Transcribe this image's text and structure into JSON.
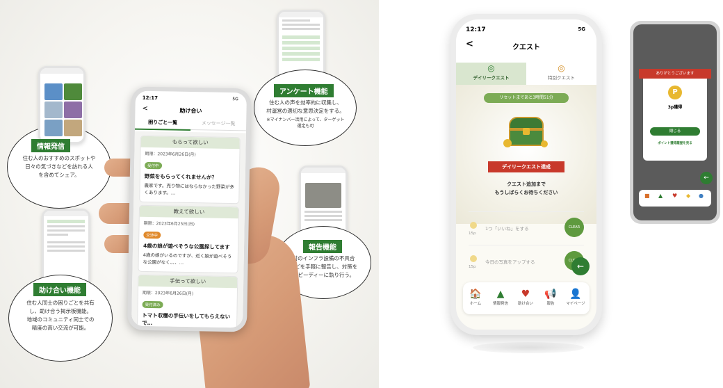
{
  "left": {
    "info_tag": "情報発信",
    "info_desc": "住む人のおすすめのスポットや\n日々の気づきなどを訪れる人\nを含めてシェア。",
    "survey_tag": "アンケート機能",
    "survey_desc": "住む人の声を効率的に収集し、\n村運営の適切な意思決定をする。",
    "survey_note": "※マイナンバー活用によって、ターゲット\n選定も可",
    "help_tag": "助け合い機能",
    "help_desc": "住む人同士の困りごとを共有\nし、助け合う掲示板機能。\n地域のコミュニティ同士での\n精度の高い交流が可能。",
    "report_tag": "報告機能",
    "report_desc": "村のインフラ設備の不具合\nなどを手軽に報告し、対策を\nスピーディーに執り行う。"
  },
  "main_phone": {
    "time": "12:17",
    "signal": "5G",
    "back": "<",
    "title": "助け合い",
    "tab_active": "困りごと一覧",
    "tab_inactive": "メッセージ一覧",
    "cards": [
      {
        "head": "もらって欲しい",
        "date": "期限：2023年6月26日(月)",
        "badge": "受付中",
        "title": "野菜をもらってくれませんか？",
        "body": "農家です。売り物にはならなかった野菜が多くあります。…"
      },
      {
        "head": "教えて欲しい",
        "date": "期限：2023年6月25日(日)",
        "badge": "交渉中",
        "title": "4歳の娘が遊べそうな公園探してます",
        "body": "4歳の娘がいるのですが、近く娘が遊べそうな公園がなく、、、…"
      },
      {
        "head": "手伝って欲しい",
        "date": "期限：2023年6月26日(月)",
        "badge": "受付済み",
        "title": "トマト収穫の手伝いをしてもらえないで…",
        "body": ""
      }
    ]
  },
  "quest_phone": {
    "time": "12:17",
    "signal": "5G",
    "back": "<",
    "title": "クエスト",
    "tab_daily": "デイリークエスト",
    "tab_special": "特別クエスト",
    "reset": "リセットまであと3時間51分",
    "banner": "デイリークエスト達成",
    "wait_line1": "クエスト追加まで",
    "wait_line2": "もうしばらくお待ちください",
    "quests": [
      {
        "text": "1つ「いいね」をする",
        "points": "15p",
        "status": "CLEAR"
      },
      {
        "text": "今日の写真をアップする",
        "points": "15p",
        "status": "CLEAR"
      }
    ],
    "nav": [
      {
        "icon": "home-icon",
        "glyph": "🏠",
        "label": "ホーム"
      },
      {
        "icon": "tree-icon",
        "glyph": "▲",
        "label": "情報発信"
      },
      {
        "icon": "heart-icon",
        "glyph": "♥",
        "label": "助け合い"
      },
      {
        "icon": "megaphone-icon",
        "glyph": "📢",
        "label": "報告"
      },
      {
        "icon": "person-icon",
        "glyph": "👤",
        "label": "マイページ"
      }
    ]
  },
  "reward_phone": {
    "banner": "ありがとうございます",
    "points": "3p獲得",
    "close": "閉じる",
    "history": "ポイント獲得履歴を見る"
  },
  "colors": {
    "green": "#2f7d32",
    "light_green": "#dfe9d7",
    "quest_green": "#7cab55",
    "red_banner": "#c8392b",
    "gold": "#e8b830"
  }
}
